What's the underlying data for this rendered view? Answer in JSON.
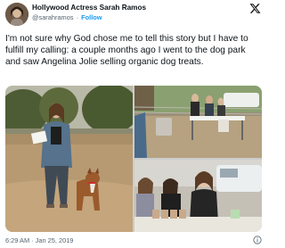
{
  "author": {
    "display_name": "Hollywood Actress Sarah Ramos",
    "handle": "@sarahramos",
    "separator": "·",
    "follow_label": "Follow"
  },
  "tweet": {
    "text": "I'm not sure why God chose me to tell this story but I have to fulfill my calling: a couple months ago I went to the dog park and saw Angelina Jolie selling organic dog treats.",
    "timestamp": "6:29 AM · Jan 25, 2019"
  },
  "icons": {
    "platform_logo": "x-logo-icon",
    "info": "info-icon",
    "avatar": "avatar-photo"
  },
  "media": {
    "count": 3,
    "photos": [
      "woman-with-dog-at-dog-park",
      "treat-stand-at-park",
      "women-at-treat-table"
    ]
  },
  "colors": {
    "text": "#0f1419",
    "secondary": "#536471",
    "accent": "#1d9bf0",
    "background": "#ffffff"
  }
}
